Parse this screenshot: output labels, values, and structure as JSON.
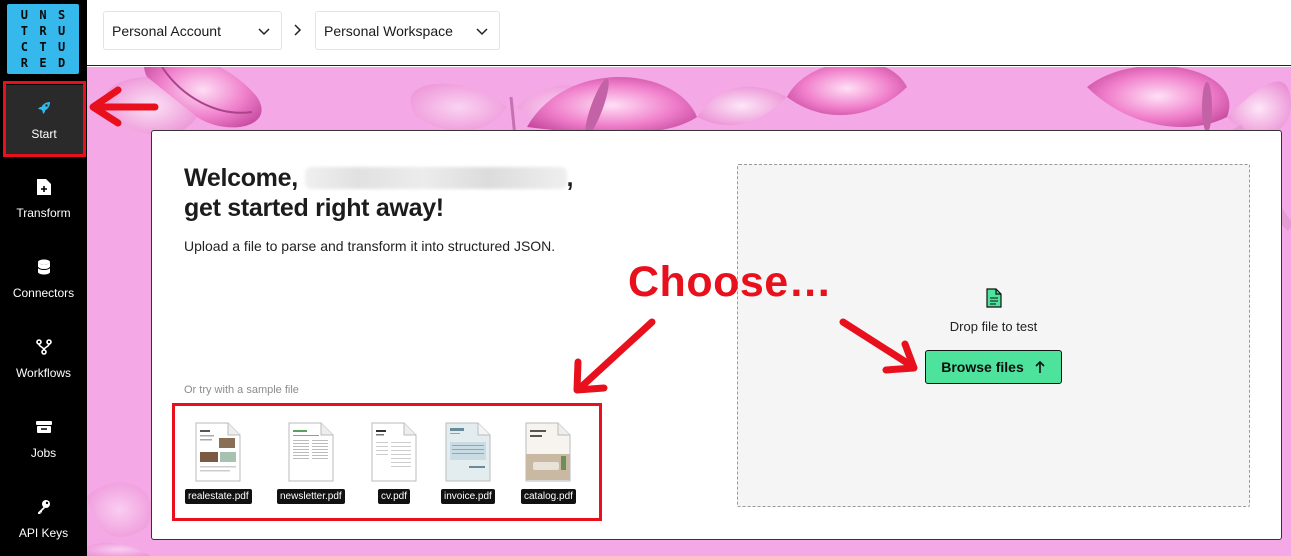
{
  "sidebar": {
    "logo_letters": [
      "U",
      "N",
      "S",
      "T",
      "R",
      "U",
      "C",
      "T",
      "U",
      "R",
      "E",
      "D"
    ],
    "items": [
      {
        "label": "Start",
        "icon": "rocket-icon",
        "active": true
      },
      {
        "label": "Transform",
        "icon": "file-plus-icon"
      },
      {
        "label": "Connectors",
        "icon": "database-icon"
      },
      {
        "label": "Workflows",
        "icon": "workflow-icon"
      },
      {
        "label": "Jobs",
        "icon": "inbox-icon"
      },
      {
        "label": "API Keys",
        "icon": "key-icon"
      }
    ]
  },
  "topbar": {
    "account_dropdown": "Personal Account",
    "workspace_dropdown": "Personal Workspace"
  },
  "welcome": {
    "prefix": "Welcome, ",
    "suffix": ",",
    "line2": "get started right away!",
    "subtitle": "Upload a file to parse and transform it into structured JSON."
  },
  "samples": {
    "caption": "Or try with a sample file",
    "files": [
      "realestate.pdf",
      "newsletter.pdf",
      "cv.pdf",
      "invoice.pdf",
      "catalog.pdf"
    ]
  },
  "dropzone": {
    "text": "Drop file to test",
    "button": "Browse files"
  },
  "annotation": {
    "text": "Choose…",
    "color": "#e8101d"
  },
  "colors": {
    "accent": "#4de39c",
    "logo_bg": "#35b8ec",
    "background": "#f5a8e6"
  }
}
